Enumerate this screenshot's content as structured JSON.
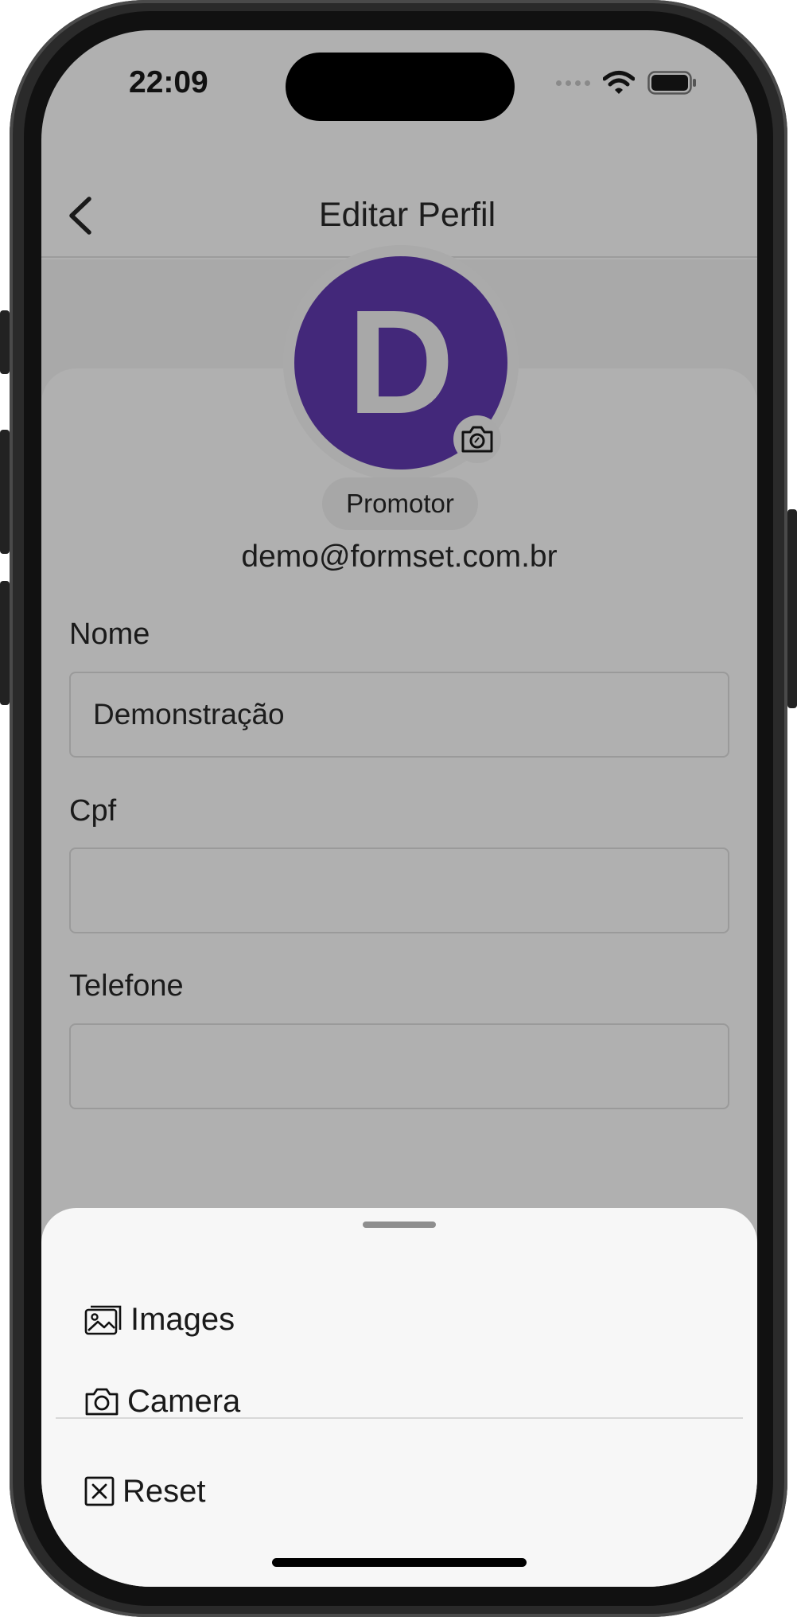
{
  "status_bar": {
    "time": "22:09"
  },
  "header": {
    "title": "Editar Perfil"
  },
  "profile": {
    "avatar_initial": "D",
    "role": "Promotor",
    "email": "demo@formset.com.br"
  },
  "form": {
    "nome_label": "Nome",
    "nome_value": "Demonstração",
    "cpf_label": "Cpf",
    "cpf_value": "",
    "telefone_label": "Telefone",
    "telefone_value": ""
  },
  "sheet": {
    "images_label": "Images",
    "camera_label": "Camera",
    "reset_label": "Reset"
  },
  "colors": {
    "avatar_bg": "#43287a",
    "overlay_bg": "#b0b0b0",
    "sheet_bg": "#f7f7f7"
  },
  "icons": [
    "back-chevron-icon",
    "signal-dots-icon",
    "wifi-icon",
    "battery-icon",
    "camera-icon",
    "images-icon",
    "close-square-icon"
  ]
}
